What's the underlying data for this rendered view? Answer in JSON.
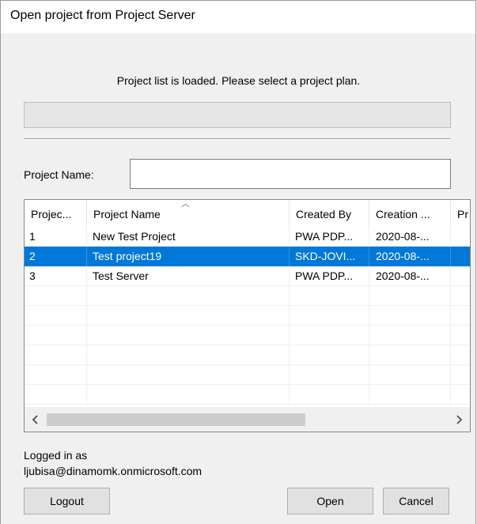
{
  "window": {
    "title": "Open project from Project Server"
  },
  "status": {
    "message": "Project list is loaded. Please select a project plan.",
    "progress_fraction": 0
  },
  "project_name": {
    "label": "Project Name:",
    "value": ""
  },
  "table": {
    "columns": [
      "Projec...",
      "Project Name",
      "Created By",
      "Creation ...",
      "Pr"
    ],
    "sort_column": "Project Name",
    "rows": [
      {
        "id": "1",
        "name": "New Test Project",
        "created_by": "PWA PDP...",
        "creation": "2020-08-...",
        "selected": false
      },
      {
        "id": "2",
        "name": "Test project19",
        "created_by": "SKD-JOVI...",
        "creation": "2020-08-...",
        "selected": true
      },
      {
        "id": "3",
        "name": "Test Server",
        "created_by": "PWA PDP...",
        "creation": "2020-08-...",
        "selected": false
      }
    ]
  },
  "scroll": {
    "left_icon": "chevron-left-icon",
    "right_icon": "chevron-right-icon"
  },
  "user": {
    "logged_label": "Logged in as",
    "email": "ljubisa@dinamomk.onmicrosoft.com"
  },
  "buttons": {
    "logout": "Logout",
    "open": "Open",
    "cancel": "Cancel"
  },
  "colors": {
    "selection": "#0078d7",
    "background": "#f0f0f0"
  }
}
